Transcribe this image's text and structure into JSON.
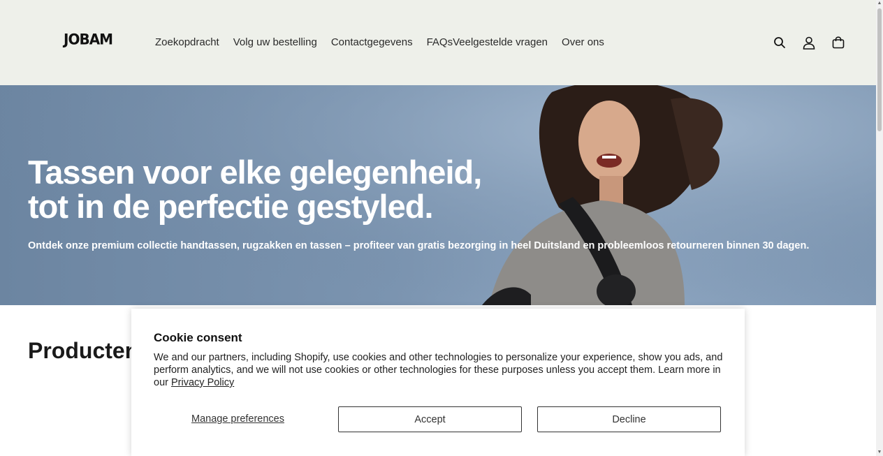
{
  "header": {
    "logo": "JOBAM",
    "nav": [
      {
        "label": "Zoekopdracht"
      },
      {
        "label": "Volg uw bestelling"
      },
      {
        "label": "Contactgegevens"
      },
      {
        "label": "FAQsVeelgestelde vragen"
      },
      {
        "label": "Over ons"
      }
    ],
    "icons": [
      "search-icon",
      "account-icon",
      "cart-icon"
    ]
  },
  "hero": {
    "title_line1": "Tassen voor elke gelegenheid,",
    "title_line2": "tot in de perfectie gestyled.",
    "subtitle": "Ontdek onze premium collectie handtassen, rugzakken en tassen – profiteer van gratis bezorging in heel Duitsland en probleemloos retourneren binnen 30 dagen."
  },
  "section": {
    "title": "Producten"
  },
  "cookie": {
    "title": "Cookie consent",
    "text": "We and our partners, including Shopify, use cookies and other technologies to personalize your experience, show you ads, and perform analytics, and we will not use cookies or other technologies for these purposes unless you accept them. Learn more in our",
    "link": "Privacy Policy",
    "manage_label": "Manage preferences",
    "accept_label": "Accept",
    "decline_label": "Decline"
  },
  "colors": {
    "header_bg": "#eef0ea",
    "hero_bg": "#7b94b0",
    "text": "#1a1a1a"
  }
}
